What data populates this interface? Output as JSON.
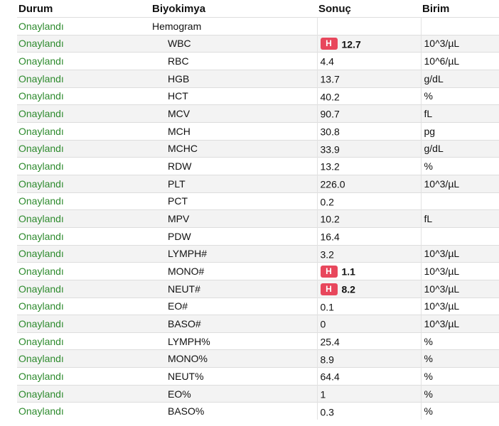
{
  "table": {
    "headers": {
      "status": "Durum",
      "test": "Biyokimya",
      "result": "Sonuç",
      "unit": "Birim"
    },
    "colors": {
      "status_ok": "#2e8b2e",
      "high_flag_bg": "#e8475c",
      "row_stripe": "#f3f3f3"
    },
    "rows": [
      {
        "status": "Onaylandı",
        "test": "Hemogram",
        "result": "",
        "unit": "",
        "flag": "",
        "group": true
      },
      {
        "status": "Onaylandı",
        "test": "WBC",
        "result": "12.7",
        "unit": "10^3/µL",
        "flag": "H",
        "group": false
      },
      {
        "status": "Onaylandı",
        "test": "RBC",
        "result": "4.4",
        "unit": "10^6/µL",
        "flag": "",
        "group": false
      },
      {
        "status": "Onaylandı",
        "test": "HGB",
        "result": "13.7",
        "unit": "g/dL",
        "flag": "",
        "group": false
      },
      {
        "status": "Onaylandı",
        "test": "HCT",
        "result": "40.2",
        "unit": "%",
        "flag": "",
        "group": false
      },
      {
        "status": "Onaylandı",
        "test": "MCV",
        "result": "90.7",
        "unit": "fL",
        "flag": "",
        "group": false
      },
      {
        "status": "Onaylandı",
        "test": "MCH",
        "result": "30.8",
        "unit": "pg",
        "flag": "",
        "group": false
      },
      {
        "status": "Onaylandı",
        "test": "MCHC",
        "result": "33.9",
        "unit": "g/dL",
        "flag": "",
        "group": false
      },
      {
        "status": "Onaylandı",
        "test": "RDW",
        "result": "13.2",
        "unit": "%",
        "flag": "",
        "group": false
      },
      {
        "status": "Onaylandı",
        "test": "PLT",
        "result": "226.0",
        "unit": "10^3/µL",
        "flag": "",
        "group": false
      },
      {
        "status": "Onaylandı",
        "test": "PCT",
        "result": "0.2",
        "unit": "",
        "flag": "",
        "group": false
      },
      {
        "status": "Onaylandı",
        "test": "MPV",
        "result": "10.2",
        "unit": "fL",
        "flag": "",
        "group": false
      },
      {
        "status": "Onaylandı",
        "test": "PDW",
        "result": "16.4",
        "unit": "",
        "flag": "",
        "group": false
      },
      {
        "status": "Onaylandı",
        "test": "LYMPH#",
        "result": "3.2",
        "unit": "10^3/µL",
        "flag": "",
        "group": false
      },
      {
        "status": "Onaylandı",
        "test": "MONO#",
        "result": "1.1",
        "unit": "10^3/µL",
        "flag": "H",
        "group": false
      },
      {
        "status": "Onaylandı",
        "test": "NEUT#",
        "result": "8.2",
        "unit": "10^3/µL",
        "flag": "H",
        "group": false
      },
      {
        "status": "Onaylandı",
        "test": "EO#",
        "result": "0.1",
        "unit": "10^3/µL",
        "flag": "",
        "group": false
      },
      {
        "status": "Onaylandı",
        "test": "BASO#",
        "result": "0",
        "unit": "10^3/µL",
        "flag": "",
        "group": false
      },
      {
        "status": "Onaylandı",
        "test": "LYMPH%",
        "result": "25.4",
        "unit": "%",
        "flag": "",
        "group": false
      },
      {
        "status": "Onaylandı",
        "test": "MONO%",
        "result": "8.9",
        "unit": "%",
        "flag": "",
        "group": false
      },
      {
        "status": "Onaylandı",
        "test": "NEUT%",
        "result": "64.4",
        "unit": "%",
        "flag": "",
        "group": false
      },
      {
        "status": "Onaylandı",
        "test": "EO%",
        "result": "1",
        "unit": "%",
        "flag": "",
        "group": false
      },
      {
        "status": "Onaylandı",
        "test": "BASO%",
        "result": "0.3",
        "unit": "%",
        "flag": "",
        "group": false
      }
    ]
  }
}
